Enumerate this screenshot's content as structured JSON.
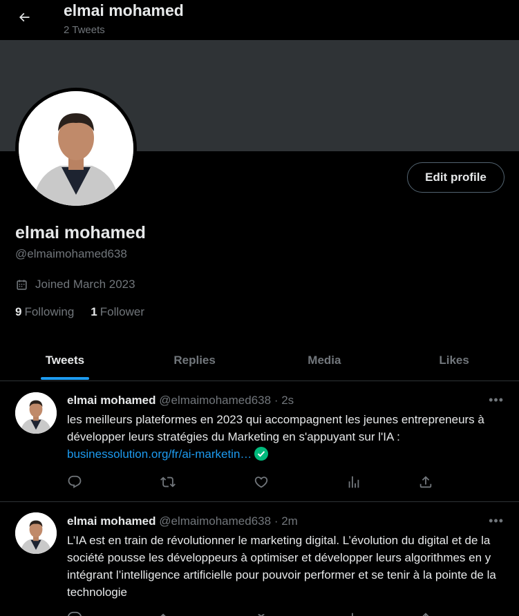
{
  "header": {
    "name": "elmai mohamed",
    "tweet_count": "2 Tweets",
    "back_icon": "arrow-left-icon"
  },
  "profile": {
    "name": "elmai mohamed",
    "handle": "@elmaimohamed638",
    "joined": "Joined March 2023",
    "following_count": "9",
    "following_label": "Following",
    "followers_count": "1",
    "followers_label": "Follower",
    "edit_label": "Edit profile",
    "banner_color": "#2f3336"
  },
  "tabs": [
    {
      "label": "Tweets"
    },
    {
      "label": "Replies"
    },
    {
      "label": "Media"
    },
    {
      "label": "Likes"
    }
  ],
  "tweets": [
    {
      "name": "elmai mohamed",
      "handle": "@elmaimohamed638",
      "time": "· 2s",
      "text": "les meilleurs plateformes en 2023 qui accompagnent les jeunes entrepreneurs à développer leurs stratégies du Marketing en s'appuyant sur l'IA : ",
      "link": "businessolution.org/fr/ai-marketin…"
    },
    {
      "name": "elmai mohamed",
      "handle": "@elmaimohamed638",
      "time": "· 2m",
      "text": "L’IA est en train de révolutionner le marketing digital. L’évolution du digital et de la société pousse les développeurs à optimiser et développer leurs algorithmes en y intégrant l’intelligence artificielle pour pouvoir performer et se tenir à la pointe de la technologie"
    }
  ],
  "more_label": "•••",
  "colors": {
    "accent": "#1d9bf0",
    "verified": "#00ba7c",
    "muted": "#71767b"
  }
}
